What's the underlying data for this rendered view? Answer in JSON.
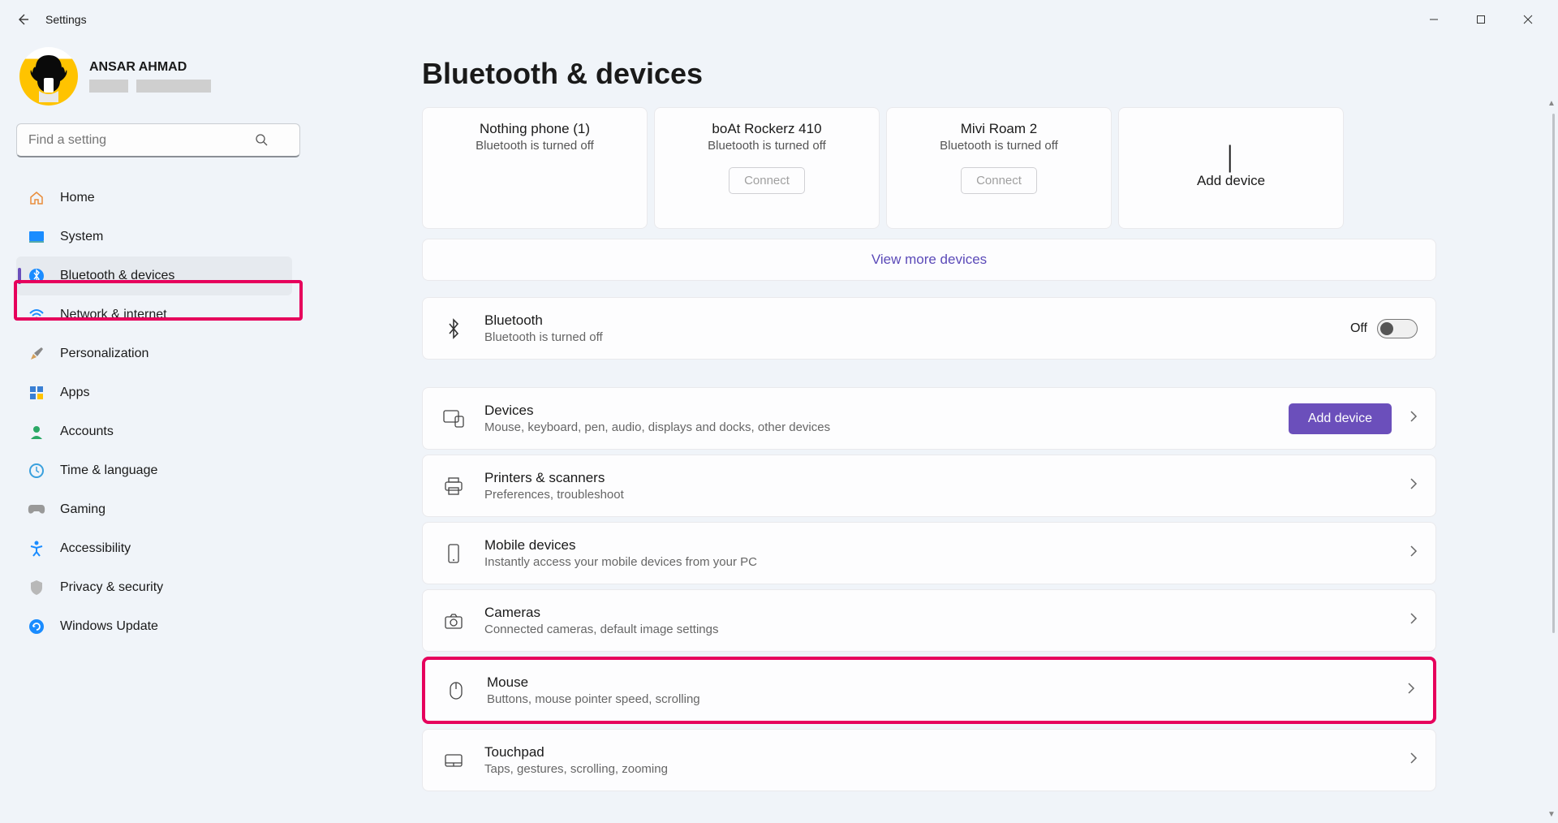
{
  "titlebar": {
    "title": "Settings"
  },
  "profile": {
    "name": "ANSAR AHMAD"
  },
  "search": {
    "placeholder": "Find a setting"
  },
  "sidebar": {
    "items": [
      {
        "label": "Home"
      },
      {
        "label": "System"
      },
      {
        "label": "Bluetooth & devices"
      },
      {
        "label": "Network & internet"
      },
      {
        "label": "Personalization"
      },
      {
        "label": "Apps"
      },
      {
        "label": "Accounts"
      },
      {
        "label": "Time & language"
      },
      {
        "label": "Gaming"
      },
      {
        "label": "Accessibility"
      },
      {
        "label": "Privacy & security"
      },
      {
        "label": "Windows Update"
      }
    ]
  },
  "main": {
    "heading": "Bluetooth & devices",
    "devices": [
      {
        "name": "Nothing phone (1)",
        "status": "Bluetooth is turned off",
        "connect": null
      },
      {
        "name": "boAt Rockerz 410",
        "status": "Bluetooth is turned off",
        "connect": "Connect"
      },
      {
        "name": "Mivi Roam 2",
        "status": "Bluetooth is turned off",
        "connect": "Connect"
      }
    ],
    "addDeviceCard": "Add device",
    "viewMore": "View more devices",
    "bluetooth": {
      "title": "Bluetooth",
      "sub": "Bluetooth is turned off",
      "toggleLabel": "Off"
    },
    "rows": [
      {
        "title": "Devices",
        "sub": "Mouse, keyboard, pen, audio, displays and docks, other devices",
        "button": "Add device"
      },
      {
        "title": "Printers & scanners",
        "sub": "Preferences, troubleshoot"
      },
      {
        "title": "Mobile devices",
        "sub": "Instantly access your mobile devices from your PC"
      },
      {
        "title": "Cameras",
        "sub": "Connected cameras, default image settings"
      },
      {
        "title": "Mouse",
        "sub": "Buttons, mouse pointer speed, scrolling"
      },
      {
        "title": "Touchpad",
        "sub": "Taps, gestures, scrolling, zooming"
      }
    ]
  }
}
